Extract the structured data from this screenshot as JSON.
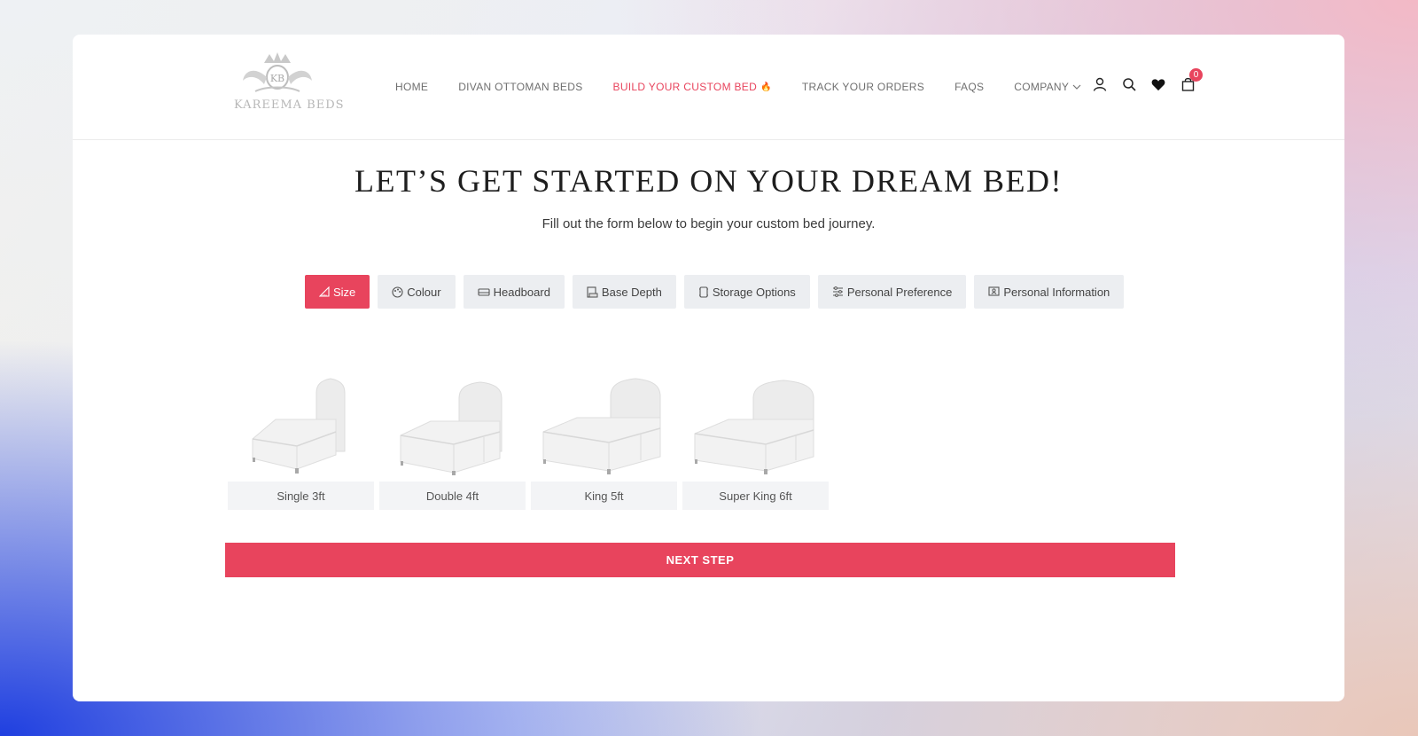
{
  "brand": {
    "logo_text": "KAREEMA BEDS",
    "monogram": "KB"
  },
  "nav": {
    "items": [
      {
        "label": "HOME"
      },
      {
        "label": "DIVAN OTTOMAN BEDS"
      },
      {
        "label": "BUILD YOUR CUSTOM BED"
      },
      {
        "label": "TRACK YOUR ORDERS"
      },
      {
        "label": "FAQS"
      },
      {
        "label": "COMPANY"
      }
    ],
    "active": "BUILD YOUR CUSTOM BED",
    "flame_glyph": "🔥"
  },
  "header_icons": {
    "account": "user-icon",
    "search": "search-icon",
    "wishlist": "heart-icon",
    "cart": "cart-icon",
    "cart_count": "0"
  },
  "hero": {
    "title": "LET’S GET STARTED ON YOUR DREAM BED!",
    "subtitle": "Fill out the form below to begin your custom bed journey."
  },
  "tabs": [
    {
      "label": "Size",
      "icon": "ruler-icon"
    },
    {
      "label": "Colour",
      "icon": "palette-icon"
    },
    {
      "label": "Headboard",
      "icon": "headboard-icon"
    },
    {
      "label": "Base Depth",
      "icon": "base-depth-icon"
    },
    {
      "label": "Storage Options",
      "icon": "storage-icon"
    },
    {
      "label": "Personal Preference",
      "icon": "sliders-icon"
    },
    {
      "label": "Personal Information",
      "icon": "id-card-icon"
    }
  ],
  "active_tab": "Size",
  "sizes": [
    {
      "label": "Single 3ft"
    },
    {
      "label": "Double 4ft"
    },
    {
      "label": "King 5ft"
    },
    {
      "label": "Super King 6ft"
    }
  ],
  "next_button": "NEXT STEP",
  "colors": {
    "accent": "#e8445d",
    "tab_bg": "#eceef1",
    "text": "#1e1e1e"
  }
}
